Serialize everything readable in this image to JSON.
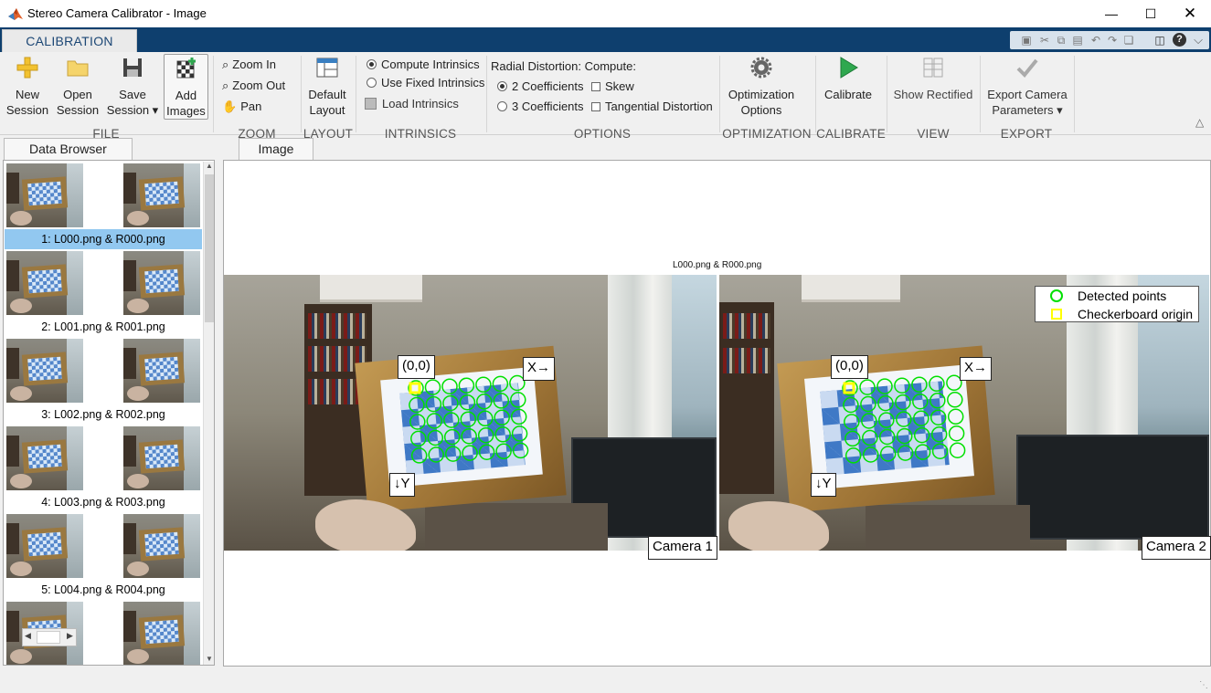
{
  "window": {
    "title": "Stereo Camera Calibrator - Image",
    "minimize_icon": "minimize-icon",
    "maximize_icon": "maximize-icon",
    "close_icon": "close-icon"
  },
  "ribbon": {
    "tab_label": "CALIBRATION",
    "file": {
      "section": "FILE",
      "new_session_1": "New",
      "new_session_2": "Session",
      "open_session_1": "Open",
      "open_session_2": "Session",
      "save_session_1": "Save",
      "save_session_2": "Session",
      "add_images_1": "Add",
      "add_images_2": "Images"
    },
    "zoom": {
      "section": "ZOOM",
      "zoom_in": "Zoom In",
      "zoom_out": "Zoom Out",
      "pan": "Pan"
    },
    "layout": {
      "section": "LAYOUT",
      "default_layout_1": "Default",
      "default_layout_2": "Layout"
    },
    "intrinsics": {
      "section": "INTRINSICS",
      "compute": "Compute Intrinsics",
      "use_fixed": "Use Fixed Intrinsics",
      "load": "Load Intrinsics",
      "selected": "compute"
    },
    "options": {
      "section": "OPTIONS",
      "heading": "Radial Distortion: Compute:",
      "two_coeff": "2 Coefficients",
      "three_coeff": "3 Coefficients",
      "skew": "Skew",
      "tangential": "Tangential Distortion",
      "selected_coeff": "2"
    },
    "optimization": {
      "section": "OPTIMIZATION",
      "opt_1": "Optimization",
      "opt_2": "Options"
    },
    "calibrate": {
      "section": "CALIBRATE",
      "label": "Calibrate"
    },
    "view": {
      "section": "VIEW",
      "label": "Show Rectified"
    },
    "export": {
      "section": "EXPORT",
      "label_1": "Export Camera",
      "label_2": "Parameters"
    }
  },
  "data_browser": {
    "tab_label": "Data Browser",
    "items": [
      {
        "caption": "1: L000.png & R000.png",
        "selected": true
      },
      {
        "caption": "2: L001.png & R001.png",
        "selected": false
      },
      {
        "caption": "3: L002.png & R002.png",
        "selected": false
      },
      {
        "caption": "4: L003.png & R003.png",
        "selected": false
      },
      {
        "caption": "5: L004.png & R004.png",
        "selected": false
      },
      {
        "caption": "",
        "selected": false
      }
    ]
  },
  "image_view": {
    "tab_label": "Image",
    "plot_title": "L000.png & R000.png",
    "camera1_label": "Camera 1",
    "camera2_label": "Camera 2",
    "origin_label": "(0,0)",
    "x_axis_label": "X→",
    "y_axis_label": "↓Y",
    "legend": {
      "detected": "Detected points",
      "origin": "Checkerboard origin",
      "detected_color": "#00e000",
      "origin_color": "#ffff00"
    }
  },
  "colors": {
    "accent": "#0e3f6e",
    "selection": "#92c8f0",
    "calibrate_green": "#2fa84f"
  }
}
